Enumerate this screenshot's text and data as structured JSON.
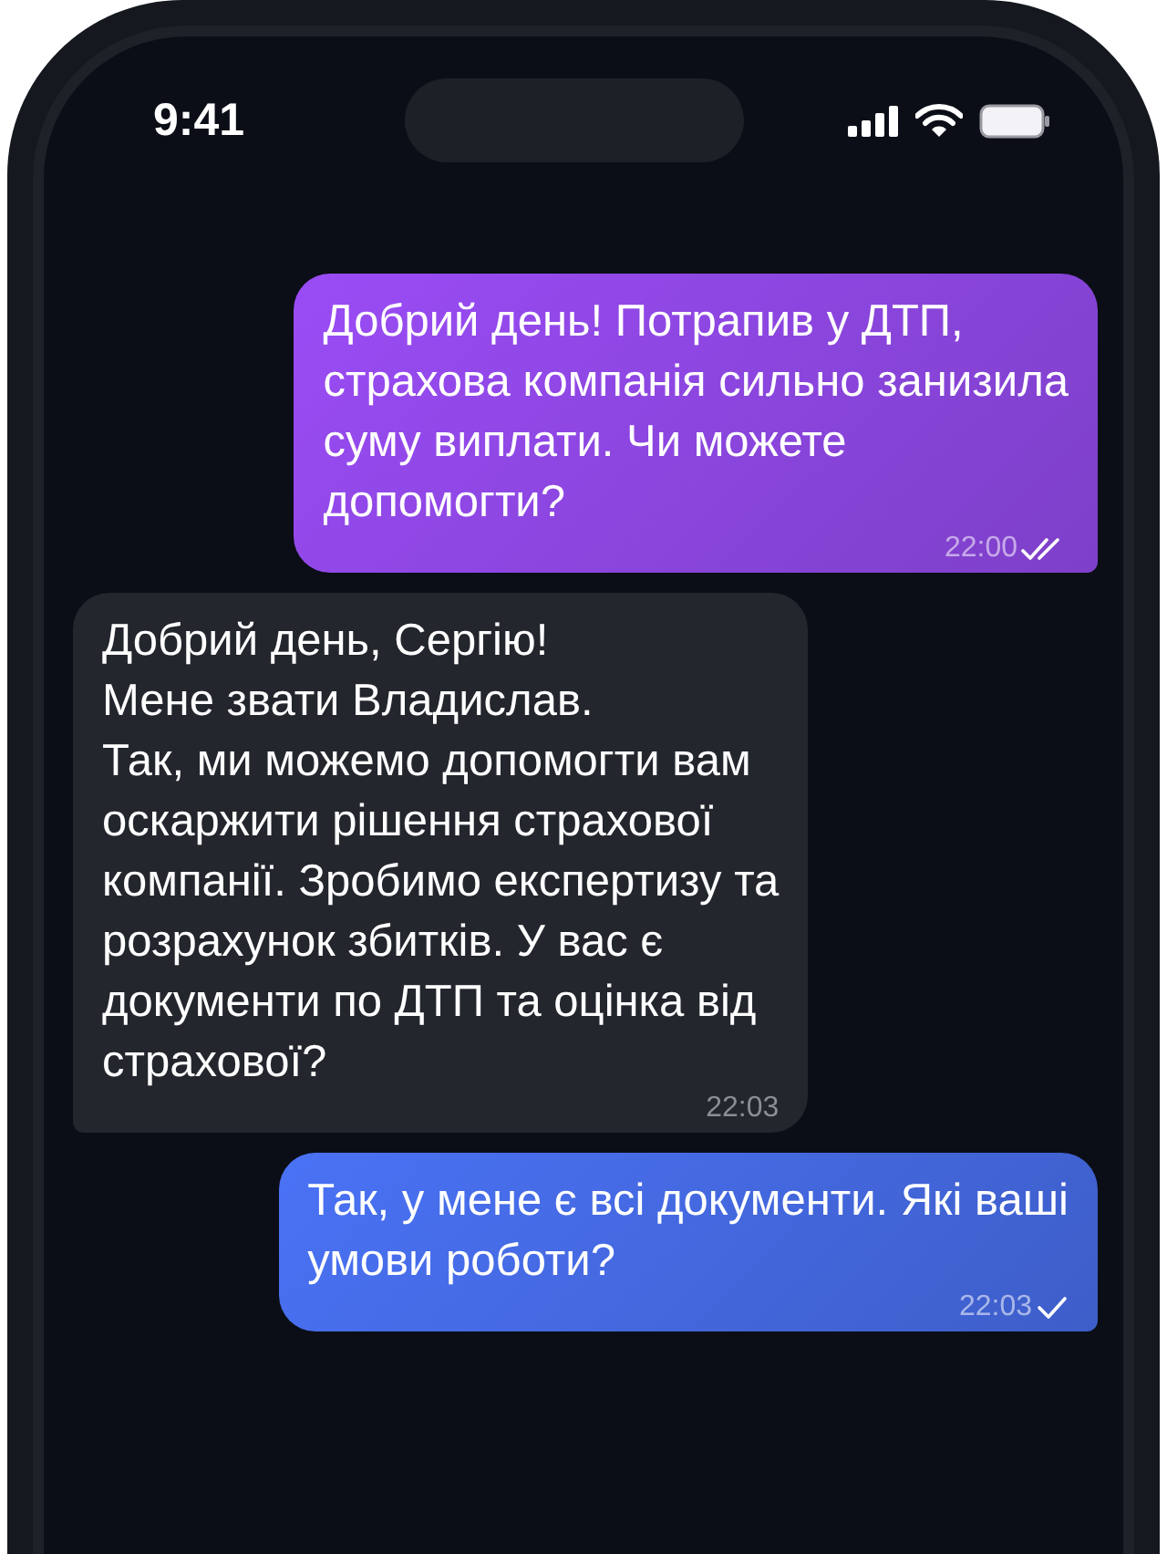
{
  "status_bar": {
    "time": "9:41"
  },
  "messages": [
    {
      "kind": "outgoing",
      "color": "#9a4cf5",
      "text": "Добрий день! Потрапив у ДТП,\nстрахова компанія сильно занизила\nсуму виплати. Чи можете\nдопомогти?",
      "time": "22:00",
      "read": true
    },
    {
      "kind": "incoming",
      "color": "#23262d",
      "text": "Добрий день, Сергію!\nМене звати Владислав.\nТак, ми можемо допомогти вам\nоскаржити рішення страхової\nкомпанії. Зробимо експертизу та\nрозрахунок збитків. У вас є\nдокументи по ДТП та оцінка від\nстрахової?",
      "time": "22:03"
    },
    {
      "kind": "outgoing",
      "color": "#4a72f5",
      "text": "Так, у мене є всі документи. Які ваші\nумови роботи?",
      "time": "22:03",
      "read": false
    }
  ]
}
